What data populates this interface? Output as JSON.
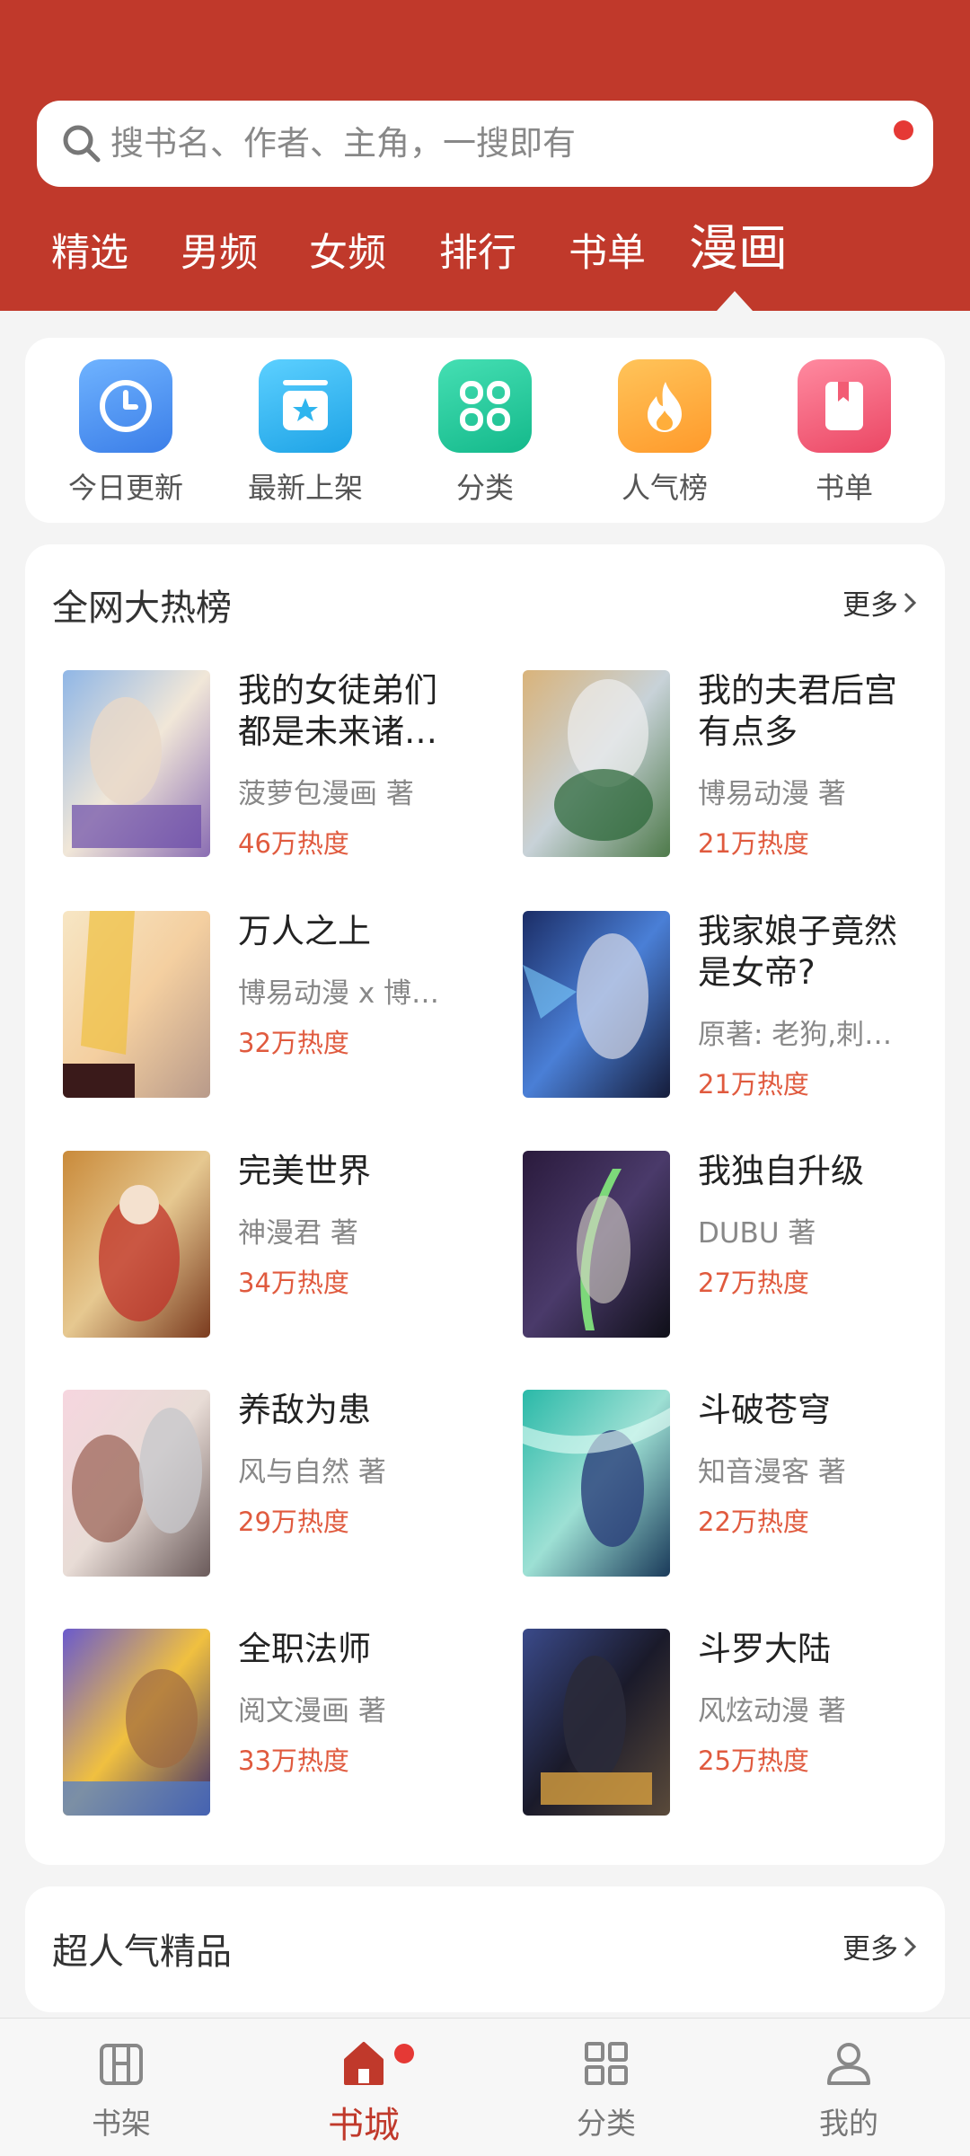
{
  "search": {
    "placeholder": "搜书名、作者、主角，一搜即有"
  },
  "tabs": [
    "精选",
    "男频",
    "女频",
    "排行",
    "书单",
    "漫画"
  ],
  "active_tab": "漫画",
  "quick_links": [
    {
      "label": "今日更新",
      "icon": "clock-icon",
      "color": "#4a90f0"
    },
    {
      "label": "最新上架",
      "icon": "new-shelf-star-icon",
      "color": "#2fb5ee"
    },
    {
      "label": "分类",
      "icon": "category-grid-icon",
      "color": "#25c9a0"
    },
    {
      "label": "人气榜",
      "icon": "flame-icon",
      "color": "#ffae3b"
    },
    {
      "label": "书单",
      "icon": "bookmark-book-icon",
      "color": "#f25c74"
    }
  ],
  "hot_list": {
    "title": "全网大热榜",
    "more": "更多",
    "books": [
      {
        "title": "我的女徒弟们都是未来诸…",
        "author": "菠萝包漫画  著",
        "heat": "46万热度"
      },
      {
        "title": "我的夫君后宫有点多",
        "author": "博易动漫  著",
        "heat": "21万热度"
      },
      {
        "title": "万人之上",
        "author": "博易动漫 x 博…",
        "heat": "32万热度"
      },
      {
        "title": "我家娘子竟然是女帝?",
        "author": "原著: 老狗,刺…",
        "heat": "21万热度"
      },
      {
        "title": "完美世界",
        "author": "神漫君  著",
        "heat": "34万热度"
      },
      {
        "title": "我独自升级",
        "author": "DUBU  著",
        "heat": "27万热度"
      },
      {
        "title": "养敌为患",
        "author": "风与自然  著",
        "heat": "29万热度"
      },
      {
        "title": "斗破苍穹",
        "author": "知音漫客  著",
        "heat": "22万热度"
      },
      {
        "title": "全职法师",
        "author": "阅文漫画  著",
        "heat": "33万热度"
      },
      {
        "title": "斗罗大陆",
        "author": "风炫动漫  著",
        "heat": "25万热度"
      }
    ]
  },
  "premium": {
    "title": "超人气精品",
    "more": "更多"
  },
  "bottom_nav": [
    {
      "label": "书架",
      "icon": "bookshelf-icon"
    },
    {
      "label": "书城",
      "icon": "home-icon"
    },
    {
      "label": "分类",
      "icon": "category-icon"
    },
    {
      "label": "我的",
      "icon": "profile-icon"
    }
  ],
  "active_nav": "书城",
  "colors": {
    "brand": "#c0392b",
    "heat": "#e05a3e"
  }
}
